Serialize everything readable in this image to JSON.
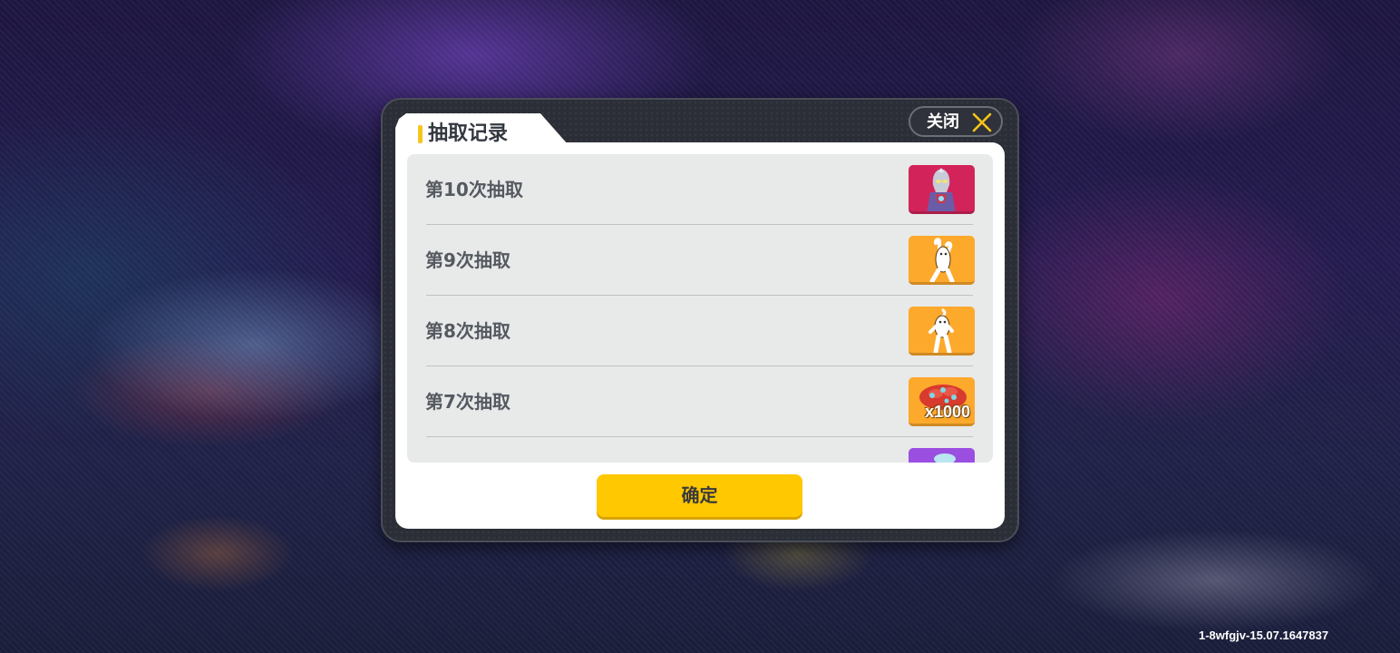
{
  "dialog": {
    "title": "抽取记录",
    "close_label": "关闭",
    "confirm_label": "确定"
  },
  "records": [
    {
      "label": "第10次抽取",
      "reward_icon": "ultraman-figure-icon",
      "tile_color": "#d2245a",
      "qty": ""
    },
    {
      "label": "第9次抽取",
      "reward_icon": "dance-emote-icon",
      "tile_color": "#fda92c",
      "qty": ""
    },
    {
      "label": "第8次抽取",
      "reward_icon": "dance-emote-icon",
      "tile_color": "#fda92c",
      "qty": ""
    },
    {
      "label": "第7次抽取",
      "reward_icon": "red-gem-pile-icon",
      "tile_color": "#fda92c",
      "qty": "x1000"
    },
    {
      "label": "",
      "reward_icon": "purple-item-icon",
      "tile_color": "#9b4fe0",
      "qty": ""
    }
  ],
  "footer": {
    "version": "1-8wfgjv-15.07.1647837"
  },
  "colors": {
    "accent_yellow": "#ffc800",
    "panel_dark": "#2b2e36"
  }
}
